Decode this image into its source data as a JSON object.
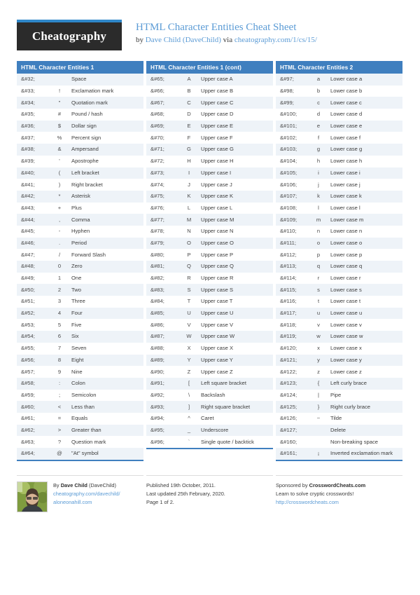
{
  "brand": {
    "logo_text": "Cheatography",
    "accent_color": "#2f87c9",
    "header_blue": "#3f7fbf"
  },
  "header": {
    "title": "HTML Character Entities Cheat Sheet",
    "by_prefix": "by ",
    "author_link": "Dave Child (DaveChild)",
    "via": " via ",
    "site_link": "cheatography.com/1/cs/15/"
  },
  "columns": [
    {
      "heading": "HTML Character Entities 1",
      "rows": [
        [
          "&#32;",
          "",
          "Space"
        ],
        [
          "&#33;",
          "!",
          "Exclamation mark"
        ],
        [
          "&#34;",
          "\"",
          "Quotation mark"
        ],
        [
          "&#35;",
          "#",
          "Pound / hash"
        ],
        [
          "&#36;",
          "$",
          "Dollar sign"
        ],
        [
          "&#37;",
          "%",
          "Percent sign"
        ],
        [
          "&#38;",
          "&",
          "Ampersand"
        ],
        [
          "&#39;",
          "'",
          "Apostrophe"
        ],
        [
          "&#40;",
          "(",
          "Left bracket"
        ],
        [
          "&#41;",
          ")",
          "Right bracket"
        ],
        [
          "&#42;",
          "*",
          "Asterisk"
        ],
        [
          "&#43;",
          "+",
          "Plus"
        ],
        [
          "&#44;",
          ",",
          "Comma"
        ],
        [
          "&#45;",
          "-",
          "Hyphen"
        ],
        [
          "&#46;",
          ".",
          "Period"
        ],
        [
          "&#47;",
          "/",
          "Forward Slash"
        ],
        [
          "&#48;",
          "0",
          "Zero"
        ],
        [
          "&#49;",
          "1",
          "One"
        ],
        [
          "&#50;",
          "2",
          "Two"
        ],
        [
          "&#51;",
          "3",
          "Three"
        ],
        [
          "&#52;",
          "4",
          "Four"
        ],
        [
          "&#53;",
          "5",
          "Five"
        ],
        [
          "&#54;",
          "6",
          "Six"
        ],
        [
          "&#55;",
          "7",
          "Seven"
        ],
        [
          "&#56;",
          "8",
          "Eight"
        ],
        [
          "&#57;",
          "9",
          "Nine"
        ],
        [
          "&#58;",
          ":",
          "Colon"
        ],
        [
          "&#59;",
          ";",
          "Semicolon"
        ],
        [
          "&#60;",
          "<",
          "Less than"
        ],
        [
          "&#61;",
          "=",
          "Equals"
        ],
        [
          "&#62;",
          ">",
          "Greater than"
        ],
        [
          "&#63;",
          "?",
          "Question mark"
        ],
        [
          "&#64;",
          "@",
          "\"At\" symbol"
        ]
      ]
    },
    {
      "heading": "HTML Character Entities 1 (cont)",
      "rows": [
        [
          "&#65;",
          "A",
          "Upper case A"
        ],
        [
          "&#66;",
          "B",
          "Upper case B"
        ],
        [
          "&#67;",
          "C",
          "Upper case C"
        ],
        [
          "&#68;",
          "D",
          "Upper case D"
        ],
        [
          "&#69;",
          "E",
          "Upper case E"
        ],
        [
          "&#70;",
          "F",
          "Upper case F"
        ],
        [
          "&#71;",
          "G",
          "Upper case G"
        ],
        [
          "&#72;",
          "H",
          "Upper case H"
        ],
        [
          "&#73;",
          "I",
          "Upper case I"
        ],
        [
          "&#74;",
          "J",
          "Upper case J"
        ],
        [
          "&#75;",
          "K",
          "Upper case K"
        ],
        [
          "&#76;",
          "L",
          "Upper case L"
        ],
        [
          "&#77;",
          "M",
          "Upper case M"
        ],
        [
          "&#78;",
          "N",
          "Upper case N"
        ],
        [
          "&#79;",
          "O",
          "Upper case O"
        ],
        [
          "&#80;",
          "P",
          "Upper case P"
        ],
        [
          "&#81;",
          "Q",
          "Upper case Q"
        ],
        [
          "&#82;",
          "R",
          "Upper case R"
        ],
        [
          "&#83;",
          "S",
          "Upper case S"
        ],
        [
          "&#84;",
          "T",
          "Upper case T"
        ],
        [
          "&#85;",
          "U",
          "Upper case U"
        ],
        [
          "&#86;",
          "V",
          "Upper case V"
        ],
        [
          "&#87;",
          "W",
          "Upper case W"
        ],
        [
          "&#88;",
          "X",
          "Upper case X"
        ],
        [
          "&#89;",
          "Y",
          "Upper case Y"
        ],
        [
          "&#90;",
          "Z",
          "Upper case Z"
        ],
        [
          "&#91;",
          "[",
          "Left square bracket"
        ],
        [
          "&#92;",
          "\\",
          "Backslash"
        ],
        [
          "&#93;",
          "]",
          "Right square bracket"
        ],
        [
          "&#94;",
          "^",
          "Caret"
        ],
        [
          "&#95;",
          "_",
          "Underscore"
        ],
        [
          "&#96;",
          "`",
          "Single quote / backtick"
        ]
      ]
    },
    {
      "heading": "HTML Character Entities 2",
      "rows": [
        [
          "&#97;",
          "a",
          "Lower case a"
        ],
        [
          "&#98;",
          "b",
          "Lower case b"
        ],
        [
          "&#99;",
          "c",
          "Lower case c"
        ],
        [
          "&#100;",
          "d",
          "Lower case d"
        ],
        [
          "&#101;",
          "e",
          "Lower case e"
        ],
        [
          "&#102;",
          "f",
          "Lower case f"
        ],
        [
          "&#103;",
          "g",
          "Lower case g"
        ],
        [
          "&#104;",
          "h",
          "Lower case h"
        ],
        [
          "&#105;",
          "i",
          "Lower case i"
        ],
        [
          "&#106;",
          "j",
          "Lower case j"
        ],
        [
          "&#107;",
          "k",
          "Lower case k"
        ],
        [
          "&#108;",
          "l",
          "Lower case l"
        ],
        [
          "&#109;",
          "m",
          "Lower case m"
        ],
        [
          "&#110;",
          "n",
          "Lower case n"
        ],
        [
          "&#111;",
          "o",
          "Lower case o"
        ],
        [
          "&#112;",
          "p",
          "Lower case p"
        ],
        [
          "&#113;",
          "q",
          "Lower case q"
        ],
        [
          "&#114;",
          "r",
          "Lower case r"
        ],
        [
          "&#115;",
          "s",
          "Lower case s"
        ],
        [
          "&#116;",
          "t",
          "Lower case t"
        ],
        [
          "&#117;",
          "u",
          "Lower case u"
        ],
        [
          "&#118;",
          "v",
          "Lower case v"
        ],
        [
          "&#119;",
          "w",
          "Lower case w"
        ],
        [
          "&#120;",
          "x",
          "Lower case x"
        ],
        [
          "&#121;",
          "y",
          "Lower case y"
        ],
        [
          "&#122;",
          "z",
          "Lower case z"
        ],
        [
          "&#123;",
          "{",
          "Left curly brace"
        ],
        [
          "&#124;",
          "|",
          "Pipe"
        ],
        [
          "&#125;",
          "}",
          "Right curly brace"
        ],
        [
          "&#126;",
          "~",
          "Tilde"
        ],
        [
          "&#127;",
          "",
          "Delete"
        ],
        [
          "&#160;",
          "",
          "Non-breaking space"
        ],
        [
          "&#161;",
          "¡",
          "Inverted exclamation mark"
        ]
      ]
    }
  ],
  "footer": {
    "author": {
      "by_prefix": "By ",
      "name": "Dave Child",
      "handle": " (DaveChild)",
      "profile_link": "cheatography.com/davechild/",
      "personal_link": "aloneonahill.com"
    },
    "publish": {
      "published": "Published 19th October, 2011.",
      "updated": "Last updated 25th February, 2020.",
      "page": "Page 1 of 2."
    },
    "sponsor": {
      "prefix": "Sponsored by ",
      "name": "CrosswordCheats.com",
      "tagline": "Learn to solve cryptic crosswords!",
      "url": "http://crosswordcheats.com"
    }
  }
}
